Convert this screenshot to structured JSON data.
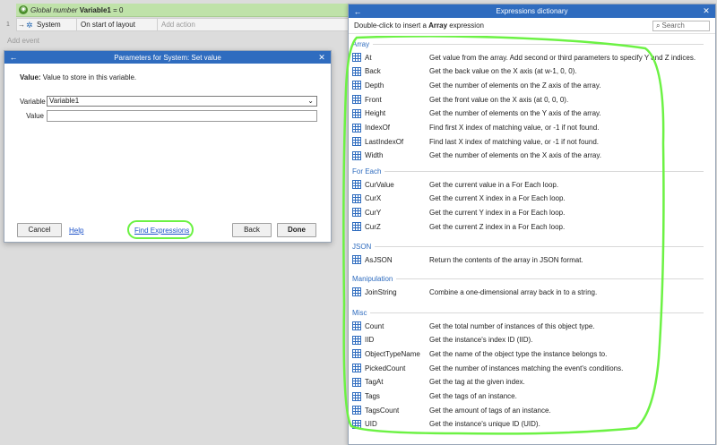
{
  "event_sheet": {
    "global_var": {
      "prefix": "Global number",
      "name": "Variable1",
      "suffix": " = 0"
    },
    "row": {
      "number": "1",
      "object": "System",
      "condition": "On start of layout",
      "add_action": "Add action"
    },
    "add_event": "Add event"
  },
  "params_dialog": {
    "title": "Parameters for System: Set value",
    "description_label": "Value:",
    "description_text": " Value to store in this variable.",
    "variable_label": "Variable",
    "variable_value": "Variable1",
    "value_label": "Value",
    "value_input": "",
    "cancel_label": "Cancel",
    "help_label": "Help",
    "find_expressions_label": "Find Expressions",
    "back_label": "Back",
    "done_label": "Done"
  },
  "expressions_dict": {
    "title": "Expressions dictionary",
    "hint_prefix": "Double-click to insert a ",
    "hint_bold": "Array",
    "hint_suffix": " expression",
    "search_placeholder": "Search",
    "categories": [
      {
        "name": "Array",
        "items": [
          {
            "name": "At",
            "desc": "Get value from the array. Add second or third parameters to specify Y and Z indices."
          },
          {
            "name": "Back",
            "desc": "Get the back value on the X axis (at w-1, 0, 0)."
          },
          {
            "name": "Depth",
            "desc": "Get the number of elements on the Z axis of the array."
          },
          {
            "name": "Front",
            "desc": "Get the front value on the X axis (at 0, 0, 0)."
          },
          {
            "name": "Height",
            "desc": "Get the number of elements on the Y axis of the array."
          },
          {
            "name": "IndexOf",
            "desc": "Find first X index of matching value, or -1 if not found."
          },
          {
            "name": "LastIndexOf",
            "desc": "Find last X index of matching value, or -1 if not found."
          },
          {
            "name": "Width",
            "desc": "Get the number of elements on the X axis of the array."
          }
        ]
      },
      {
        "name": "For Each",
        "items": [
          {
            "name": "CurValue",
            "desc": "Get the current value in a For Each loop."
          },
          {
            "name": "CurX",
            "desc": "Get the current X index in a For Each loop."
          },
          {
            "name": "CurY",
            "desc": "Get the current Y index in a For Each loop."
          },
          {
            "name": "CurZ",
            "desc": "Get the current Z index in a For Each loop."
          }
        ]
      },
      {
        "name": "JSON",
        "items": [
          {
            "name": "AsJSON",
            "desc": "Return the contents of the array in JSON format."
          }
        ]
      },
      {
        "name": "Manipulation",
        "items": [
          {
            "name": "JoinString",
            "desc": "Combine a one-dimensional array back in to a string."
          }
        ]
      },
      {
        "name": "Misc",
        "items": [
          {
            "name": "Count",
            "desc": "Get the total number of instances of this object type."
          },
          {
            "name": "IID",
            "desc": "Get the instance's index ID (IID)."
          },
          {
            "name": "ObjectTypeName",
            "desc": "Get the name of the object type the instance belongs to."
          },
          {
            "name": "PickedCount",
            "desc": "Get the number of instances matching the event's conditions."
          },
          {
            "name": "TagAt",
            "desc": "Get the tag at the given index."
          },
          {
            "name": "Tags",
            "desc": "Get the tags of an instance."
          },
          {
            "name": "TagsCount",
            "desc": "Get the amount of tags of an instance."
          },
          {
            "name": "UID",
            "desc": "Get the instance's unique ID (UID)."
          }
        ]
      }
    ]
  },
  "colors": {
    "titlebar": "#2f6cbf",
    "category": "#2f6cbf",
    "highlight": "#6cf244",
    "global_var_bg": "#bfe2a9"
  }
}
